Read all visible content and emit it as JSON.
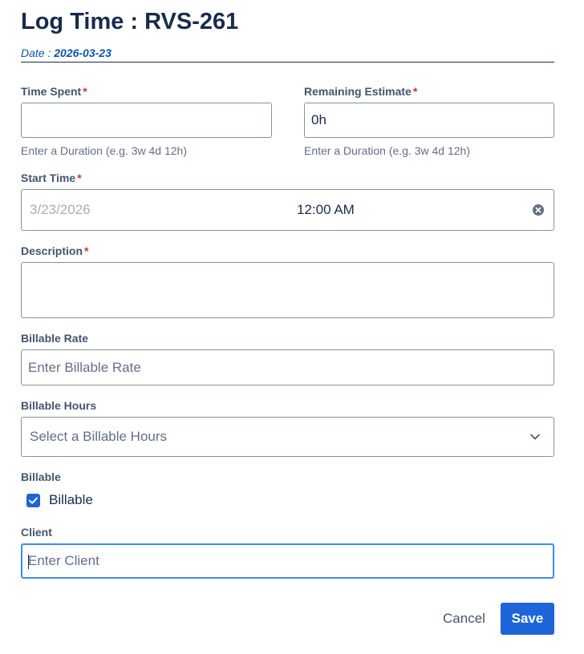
{
  "dialog": {
    "title": "Log Time : RVS-261",
    "date_label": "Date : ",
    "date_value": "2026-03-23"
  },
  "fields": {
    "time_spent": {
      "label": "Time Spent",
      "required_mark": "*",
      "value": "",
      "helper": "Enter a Duration (e.g. 3w 4d 12h)"
    },
    "remaining_estimate": {
      "label": "Remaining Estimate",
      "required_mark": "*",
      "value": "0h",
      "helper": "Enter a Duration (e.g. 3w 4d 12h)"
    },
    "start_time": {
      "label": "Start Time",
      "required_mark": "*",
      "date_placeholder": "3/23/2026",
      "time_value": "12:00 AM"
    },
    "description": {
      "label": "Description",
      "required_mark": "*",
      "value": ""
    },
    "billable_rate": {
      "label": "Billable Rate",
      "placeholder": "Enter Billable Rate"
    },
    "billable_hours": {
      "label": "Billable Hours",
      "placeholder": "Select a Billable Hours"
    },
    "billable": {
      "label": "Billable",
      "checkbox_label": "Billable",
      "checked": true
    },
    "client": {
      "label": "Client",
      "placeholder": "Enter Client"
    }
  },
  "actions": {
    "cancel_label": "Cancel",
    "save_label": "Save"
  },
  "colors": {
    "primary": "#1d65d9",
    "required": "#c9372c",
    "focus_border": "#388bff",
    "date_link": "#0c56a8"
  },
  "icons": {
    "clear": "clear-icon",
    "dropdown": "chevron-down-icon",
    "checkbox": "check-icon"
  }
}
